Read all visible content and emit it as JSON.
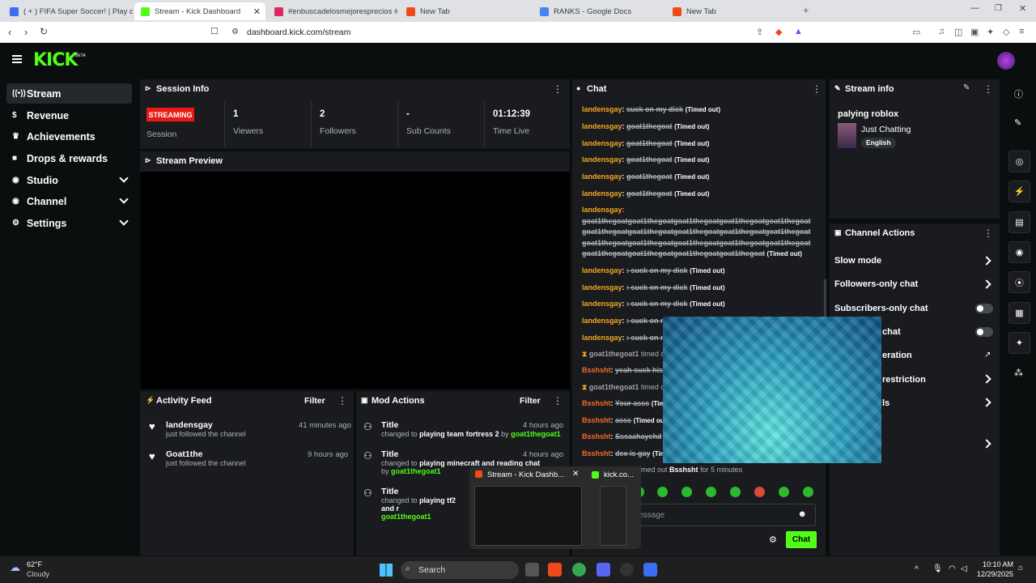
{
  "browser": {
    "tabs": [
      {
        "label": "( + ) FIFA Super Soccer! | Play on Ro..."
      },
      {
        "label": "Stream - Kick Dashboard"
      },
      {
        "label": "#enbuscadelosmejoresprecios #funn..."
      },
      {
        "label": "New Tab"
      },
      {
        "label": "RANKS - Google Docs"
      },
      {
        "label": "New Tab"
      }
    ],
    "url": "dashboard.kick.com/stream"
  },
  "sidebar": {
    "items": [
      {
        "label": "Stream",
        "icon": "broadcast-icon"
      },
      {
        "label": "Revenue",
        "icon": "dollar-icon"
      },
      {
        "label": "Achievements",
        "icon": "trophy-icon"
      },
      {
        "label": "Drops & rewards",
        "icon": "gift-icon"
      },
      {
        "label": "Studio",
        "icon": "studio-icon"
      },
      {
        "label": "Channel",
        "icon": "channel-icon"
      },
      {
        "label": "Settings",
        "icon": "gear-icon"
      }
    ]
  },
  "session": {
    "title": "Session Info",
    "status": "STREAMING",
    "status_label": "Session",
    "stats": [
      {
        "value": "1",
        "label": "Viewers"
      },
      {
        "value": "2",
        "label": "Followers"
      },
      {
        "value": "-",
        "label": "Sub Counts"
      },
      {
        "value": "01:12:39",
        "label": "Time Live"
      }
    ]
  },
  "preview": {
    "title": "Stream Preview"
  },
  "activity": {
    "title": "Activity Feed",
    "filter": "Filter",
    "items": [
      {
        "name": "landensgay",
        "sub": "just followed the channel",
        "time": "41 minutes ago"
      },
      {
        "name": "Goat1the",
        "sub": "just followed the channel",
        "time": "9 hours ago"
      }
    ]
  },
  "mod": {
    "title": "Mod Actions",
    "filter": "Filter",
    "items": [
      {
        "title": "Title",
        "time": "4 hours ago",
        "pre": "changed to",
        "value": "playing team fortress 2",
        "by": "by",
        "user": "goat1thegoat1"
      },
      {
        "title": "Title",
        "time": "4 hours ago",
        "pre": "changed to",
        "value": "playing minecraft and reading chat",
        "by": "by",
        "user": "goat1thegoat1"
      },
      {
        "title": "Title",
        "time": "",
        "pre": "changed to",
        "value": "playing tf2 and r",
        "by": "",
        "user": "goat1thegoat1"
      }
    ]
  },
  "chat": {
    "title": "Chat",
    "lines": [
      {
        "user": "landensgay",
        "msg": "suck on my dick",
        "tag": "(Timed out)"
      },
      {
        "user": "landensgay",
        "msg": "goat1thegoat",
        "tag": "(Timed out)"
      },
      {
        "user": "landensgay",
        "msg": "goat1thegoat",
        "tag": "(Timed out)"
      },
      {
        "user": "landensgay",
        "msg": "goat1thegoat",
        "tag": "(Timed out)"
      },
      {
        "user": "landensgay",
        "msg": "goat1thegoat",
        "tag": "(Timed out)"
      },
      {
        "user": "landensgay",
        "msg": "goat1thegoat",
        "tag": "(Timed out)"
      }
    ],
    "long_line": {
      "user": "landensgay:",
      "msg": "goat1thegoatgoat1thegoatgoat1thegoatgoat1thegoatgoat1thegoatgoat1thegoatgoat1thegoatgoat1thegoatgoat1thegoatgoat1thegoatgoat1thegoatgoat1thegoatgoat1thegoatgoat1thegoatgoat1thegoatgoat1thegoatgoat1thegoatgoat1thegoatgoat1thegoat",
      "tag": "(Timed out)"
    },
    "lines2": [
      {
        "user": "landensgay",
        "msg": ": suck on my dick",
        "tag": "(Timed out)"
      },
      {
        "user": "landensgay",
        "msg": ": suck on my dick",
        "tag": "(Timed out)"
      },
      {
        "user": "landensgay",
        "msg": ": suck on my dick",
        "tag": "(Timed out)"
      },
      {
        "user": "landensgay",
        "msg": ": suck on m",
        "tag": ""
      },
      {
        "user": "landensgay",
        "msg": ": suck on m",
        "tag": ""
      }
    ],
    "system1": {
      "user": "goat1thegoat1",
      "text": "timed ou"
    },
    "bsss1": {
      "user": "Bsshsht",
      "msg": "yeah suck his c"
    },
    "system2": {
      "user": "goat1thegoat1",
      "text": "timed ou"
    },
    "bsss2": {
      "user": "Bsshsht",
      "msg": "Your asss",
      "tag": "(Time"
    },
    "bsss3": {
      "user": "Bsshsht",
      "msg": "asss",
      "tag": "(Timed out)"
    },
    "bsss4": {
      "user": "Bsshsht",
      "msg": "Sssaahayehd",
      "tag": "("
    },
    "bsss5": {
      "user": "Bsshsht",
      "msg": "dex is gay",
      "tag": "(Tim"
    },
    "system3": {
      "pre": "imed out",
      "user": "Bsshsht",
      "post": "for 5 minutes"
    },
    "input_placeholder": "essage",
    "send": "Chat"
  },
  "stream_info": {
    "title": "Stream info",
    "stream_title": "palying roblox",
    "category": "Just Chatting",
    "language": "English"
  },
  "channel_actions": {
    "title": "Channel Actions",
    "items": [
      {
        "label": "Slow mode"
      },
      {
        "label": "Followers-only chat"
      },
      {
        "label": "Subscribers-only chat"
      },
      {
        "label": "chat"
      },
      {
        "label": "eration"
      },
      {
        "label": "restriction"
      },
      {
        "label": "ls"
      }
    ]
  },
  "thumbs": {
    "t1": "Stream - Kick Dashb...",
    "t2": "kick.co..."
  },
  "taskbar": {
    "temp": "62°F",
    "weather": "Cloudy",
    "search": "Search",
    "time": "10:10 AM",
    "date": "12/29/2025"
  },
  "colors": {
    "accent": "#53fc18",
    "streaming": "#e91916",
    "username": "#f5a623"
  }
}
